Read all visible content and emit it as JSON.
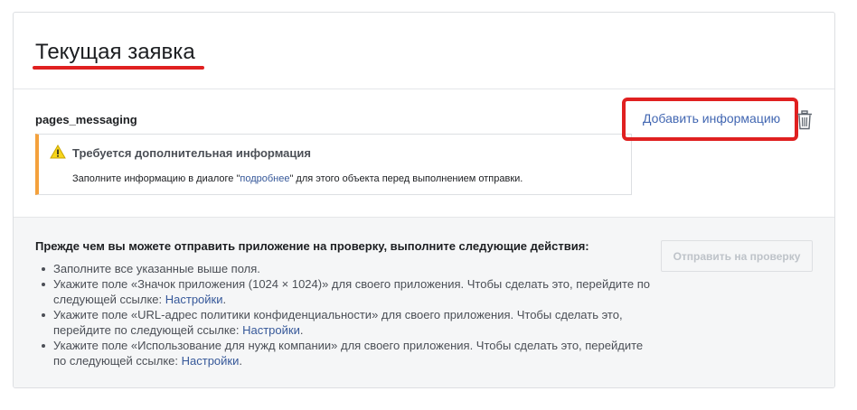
{
  "header": {
    "title": "Текущая заявка"
  },
  "permission": {
    "name": "pages_messaging",
    "add_info_label": "Добавить информацию",
    "notice": {
      "title": "Требуется дополнительная информация",
      "text_before": "Заполните информацию в диалоге \"",
      "link": "подробнее",
      "text_after": "\" для этого объекта перед выполнением отправки."
    }
  },
  "footer": {
    "heading": "Прежде чем вы можете отправить приложение на проверку, выполните следующие действия:",
    "submit_label": "Отправить на проверку",
    "steps": [
      {
        "text": "Заполните все указанные выше поля."
      },
      {
        "text": "Укажите поле «Значок приложения (1024 × 1024)» для своего приложения. Чтобы сделать это, перейдите по следующей ссылке: ",
        "link": "Настройки"
      },
      {
        "text": "Укажите поле «URL-адрес политики конфиденциальности» для своего приложения. Чтобы сделать это, перейдите по следующей ссылке: ",
        "link": "Настройки"
      },
      {
        "text": "Укажите поле «Использование для нужд компании» для своего приложения. Чтобы сделать это, перейдите по следующей ссылке: ",
        "link": "Настройки"
      }
    ],
    "period": "."
  },
  "colors": {
    "accent_red": "#e02020",
    "warning": "#f4a13c",
    "link": "#4267b2"
  },
  "icons": {
    "warning": "warning-triangle-icon",
    "trash": "trash-icon"
  }
}
